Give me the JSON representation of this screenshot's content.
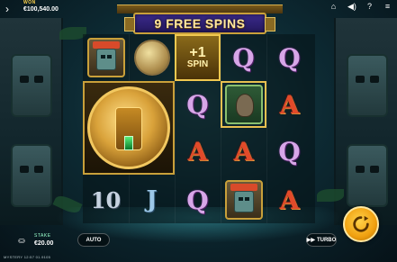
{
  "app": {
    "title": ""
  },
  "hud_top": {
    "win_label": "WON",
    "win_value": "€100,540.00",
    "menu_icon": "chevron-right-icon",
    "icons": [
      "home-icon",
      "sound-icon",
      "help-icon",
      "menu-icon"
    ]
  },
  "banner": {
    "text": "9 FREE SPINS"
  },
  "reels": {
    "plus_spin_line1": "+1",
    "plus_spin_line2": "SPIN",
    "col0": [
      "mask",
      "big-gold",
      "big-gold",
      "10"
    ],
    "col1": [
      "coin",
      "big-gold",
      "big-gold",
      "J"
    ],
    "col2": [
      "+1 SPIN",
      "Q",
      "A",
      "Q"
    ],
    "col3": [
      "Q",
      "idol",
      "A",
      "mask"
    ],
    "col4": [
      "Q",
      "A",
      "Q",
      "A"
    ]
  },
  "symbol_text": {
    "ten": "10",
    "jack": "J",
    "queen": "Q",
    "ace": "A"
  },
  "hud_bottom": {
    "bet_label": "STAKE",
    "bet_value": "€20.00",
    "auto_label": "AUTO",
    "turbo_label": "TURBO",
    "status_line": "MYSTERY  12:57  01.9105"
  },
  "colors": {
    "accent_gold": "#c9a03a",
    "banner_purple": "#3a2a8a",
    "spin_button": "#f0a010"
  }
}
